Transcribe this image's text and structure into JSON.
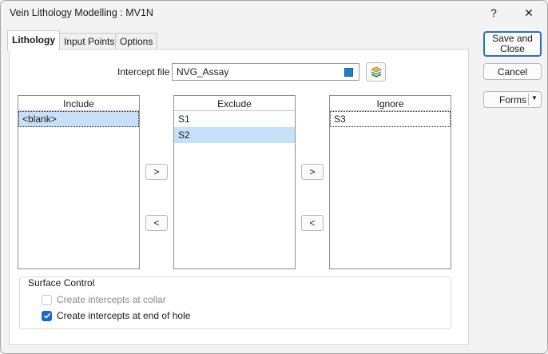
{
  "window": {
    "title": "Vein Lithology Modelling : MV1N",
    "help_glyph": "?",
    "close_glyph": "✕"
  },
  "tabs": [
    {
      "label": "Lithology",
      "active": true
    },
    {
      "label": "Input Points",
      "active": false
    },
    {
      "label": "Options",
      "active": false
    }
  ],
  "intercept": {
    "label": "Intercept file",
    "value": "NVG_Assay",
    "accent": "#1f7fc7",
    "browse_icon": "layers-icon"
  },
  "lists": {
    "include": {
      "header": "Include",
      "items": [
        "<blank>"
      ]
    },
    "exclude": {
      "header": "Exclude",
      "items": [
        "S1",
        "S2"
      ]
    },
    "ignore": {
      "header": "Ignore",
      "items": [
        "S3"
      ]
    }
  },
  "arrows": {
    "right": ">",
    "left": "<"
  },
  "surface_control": {
    "legend": "Surface Control",
    "collar_label": "Create intercepts at collar",
    "collar_checked": false,
    "collar_enabled": false,
    "end_label": "Create intercepts at end of hole",
    "end_checked": true
  },
  "side_buttons": {
    "save_close": "Save and Close",
    "cancel": "Cancel",
    "forms": "Forms",
    "forms_dropdown": "▼"
  },
  "colors": {
    "selection": "#c6e0f7",
    "primary_border": "#2f6fb8",
    "checkbox_checked": "#1f67c2"
  }
}
